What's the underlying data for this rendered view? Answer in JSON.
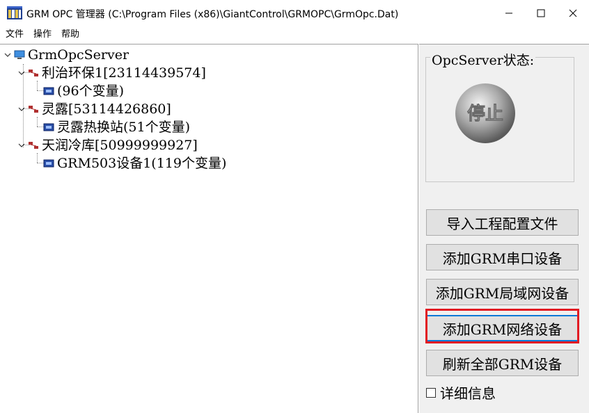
{
  "window": {
    "title": "GRM OPC 管理器 (C:\\Program Files (x86)\\GiantControl\\GRMOPC\\GrmOpc.Dat)",
    "app_icon": "grm-app-icon",
    "controls": {
      "minimize": "minimize-icon",
      "maximize": "maximize-icon",
      "close": "close-icon"
    }
  },
  "menu": [
    "文件",
    "操作",
    "帮助"
  ],
  "tree": {
    "root": {
      "label": "GrmOpcServer",
      "icon": "computer-icon"
    },
    "nodes": [
      {
        "label": "利治环保1[23114439574]",
        "icon": "network-device-icon",
        "child": {
          "label": "(96个变量)",
          "icon": "module-icon"
        }
      },
      {
        "label": "灵露[53114426860]",
        "icon": "network-device-icon",
        "child": {
          "label": "灵露热换站(51个变量)",
          "icon": "module-icon"
        }
      },
      {
        "label": "天润冷库[50999999927]",
        "icon": "network-device-icon",
        "child": {
          "label": "GRM503设备1(119个变量)",
          "icon": "module-icon"
        }
      }
    ]
  },
  "status_panel": {
    "label": "OpcServer状态:",
    "indicator_text": "停止",
    "indicator_icon": "stop-ball-icon"
  },
  "buttons": {
    "import": "导入工程配置文件",
    "add_serial": "添加GRM串口设备",
    "add_lan": "添加GRM局域网设备",
    "add_network": "添加GRM网络设备",
    "refresh": "刷新全部GRM设备"
  },
  "details_checkbox": {
    "label": "详细信息",
    "checked": false
  },
  "colors": {
    "highlight": "#e21b23",
    "focus": "#0078d7",
    "panel": "#f0f0f0"
  }
}
